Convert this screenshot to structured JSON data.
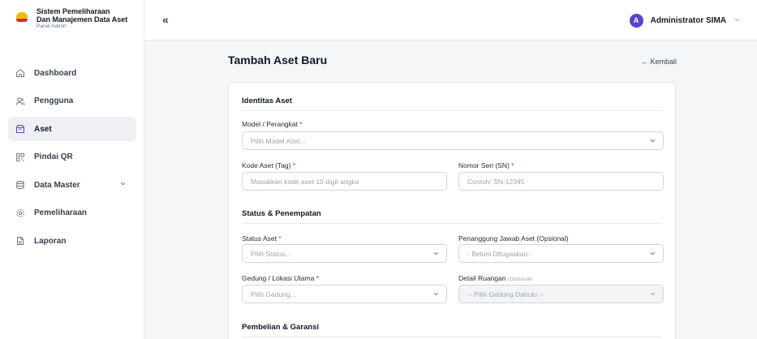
{
  "brand": {
    "title_line1": "Sistem Pemeliharaan",
    "title_line2": "Dan Manajemen Data Aset",
    "subtitle": "Panel Admin"
  },
  "sidebar": {
    "items": [
      {
        "label": "Dashboard",
        "icon": "home-icon"
      },
      {
        "label": "Pengguna",
        "icon": "users-icon"
      },
      {
        "label": "Aset",
        "icon": "box-icon",
        "active": true
      },
      {
        "label": "Pindai QR",
        "icon": "qr-icon"
      },
      {
        "label": "Data Master",
        "icon": "database-icon",
        "has_submenu": true
      },
      {
        "label": "Pemeliharaan",
        "icon": "gear-icon"
      },
      {
        "label": "Laporan",
        "icon": "document-icon"
      }
    ]
  },
  "topbar": {
    "collapse_glyph": "«",
    "user_initial": "A",
    "user_name": "Administrator SIMA"
  },
  "page": {
    "title": "Tambah Aset Baru",
    "back_label": "← Kembali"
  },
  "form": {
    "section_identitas": "Identitas Aset",
    "model_label": "Model / Perangkat",
    "model_placeholder": "Pilih Model Aset...",
    "kode_label": "Kode Aset (Tag)",
    "kode_placeholder": "Masukkan kode aset 10 digit angka",
    "seri_label": "Nomor Seri (SN)",
    "seri_placeholder": "Contoh: SN-12345",
    "section_status": "Status & Penempatan",
    "status_label": "Status Aset",
    "status_placeholder": "Pilih Status...",
    "pj_label": "Penanggung Jawab Aset (Opsional)",
    "pj_placeholder": "- Belum Ditugaskan -",
    "gedung_label": "Gedung / Lokasi Utama",
    "gedung_placeholder": "Pilih Gedung...",
    "ruangan_label": "Detail Ruangan",
    "ruangan_optional": "(Opsional)",
    "ruangan_placeholder": "-- Pilih Gedung Dahulu --",
    "section_pembelian": "Pembelian & Garansi",
    "required_mark": "*"
  },
  "colors": {
    "accent": "#5b3fd6",
    "required": "#dc2626",
    "logo_yellow": "#f5b800",
    "logo_red": "#d6312b"
  }
}
